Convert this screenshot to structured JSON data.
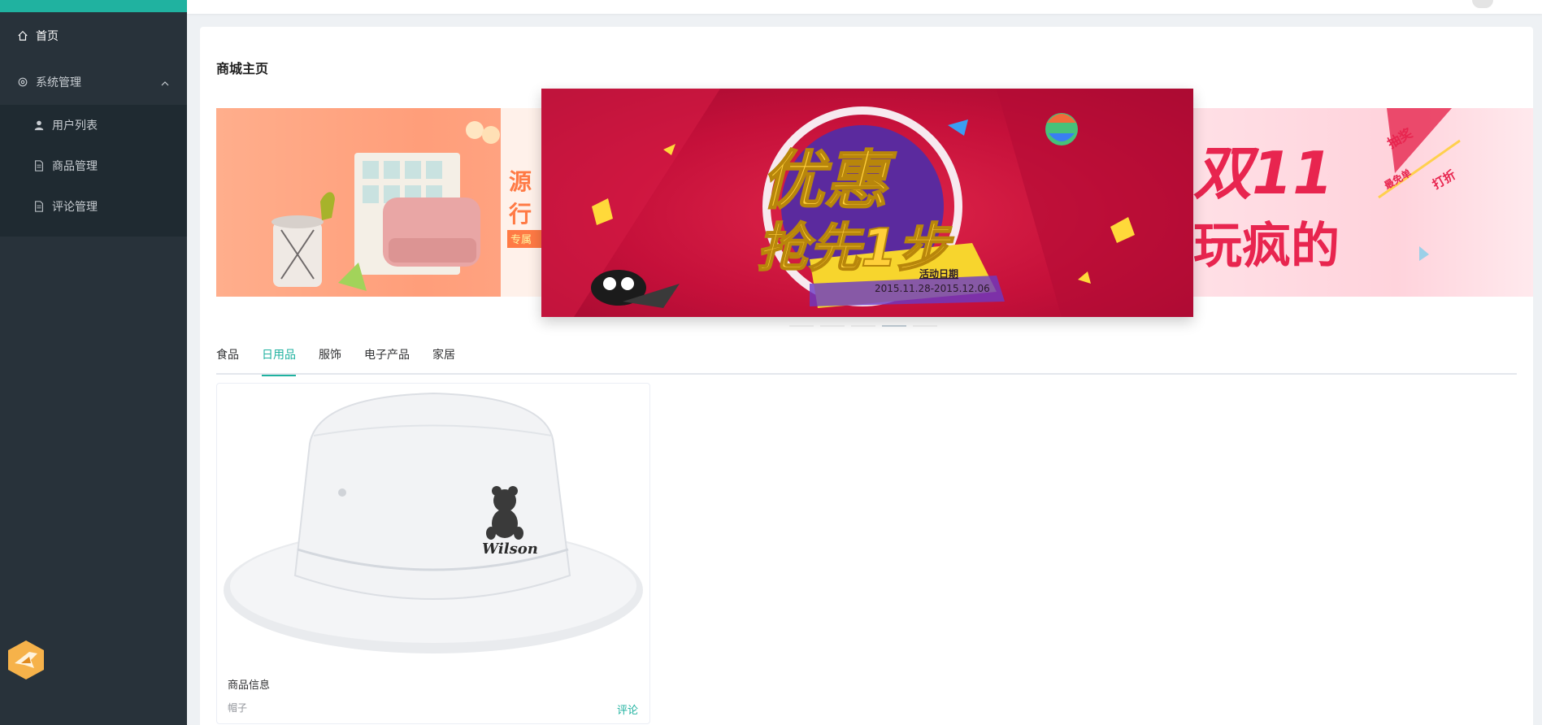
{
  "sidebar": {
    "items": [
      {
        "label": "首页",
        "icon": "home-icon"
      },
      {
        "label": "系统管理",
        "icon": "gear-icon",
        "expanded": true,
        "children": [
          {
            "label": "用户列表",
            "icon": "user-icon"
          },
          {
            "label": "商品管理",
            "icon": "document-icon"
          },
          {
            "label": "评论管理",
            "icon": "document-icon"
          }
        ]
      }
    ]
  },
  "page": {
    "title": "商城主页"
  },
  "carousel": {
    "left_slide_text": "源\n行\n专属",
    "center_slide": {
      "headline_1": "优惠",
      "headline_2": "抢先1步",
      "event_label": "活动日期",
      "event_dates": "2015.11.28-2015.12.06"
    },
    "right_slide": {
      "headline_1": "双11",
      "headline_2": "玩疯的",
      "badge_1": "抽奖",
      "badge_2": "最免单",
      "badge_3": "打折"
    },
    "indicator_count": 5,
    "active_index": 3
  },
  "tabs": [
    {
      "label": "食品",
      "active": false
    },
    {
      "label": "日用品",
      "active": true
    },
    {
      "label": "服饰",
      "active": false
    },
    {
      "label": "电子产品",
      "active": false
    },
    {
      "label": "家居",
      "active": false
    }
  ],
  "product": {
    "title": "商品信息",
    "name": "帽子",
    "action": "评论",
    "brand_text": "Wilson"
  },
  "colors": {
    "sidebar_bg": "#28323a",
    "accent": "#20b2a0",
    "banner_red": "#c5103a"
  }
}
